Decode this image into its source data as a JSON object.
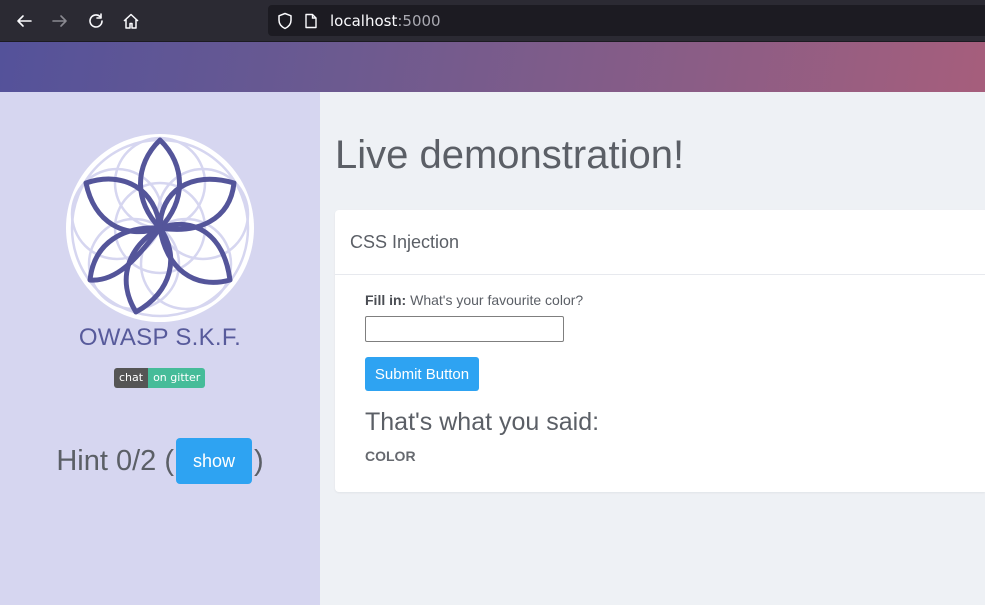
{
  "browser": {
    "url_host": "localhost",
    "url_port": ":5000"
  },
  "sidebar": {
    "brand": "OWASP S.K.F.",
    "badge_left": "chat",
    "badge_right": "on gitter",
    "hint_prefix": "Hint 0/2 (",
    "hint_button": "show",
    "hint_suffix": ")"
  },
  "main": {
    "title": "Live demonstration!",
    "card": {
      "header": "CSS Injection",
      "fill_label_bold": "Fill in:",
      "fill_label_text": " What's your favourite color?",
      "input_value": "",
      "submit_label": "Submit Button",
      "result_heading": "That's what you said:",
      "result_value": "COLOR"
    }
  },
  "colors": {
    "accent": "#2ea3f2",
    "sidebar_bg": "#d6d6f0",
    "logo": "#54559a",
    "gitter": "#46bc99"
  }
}
